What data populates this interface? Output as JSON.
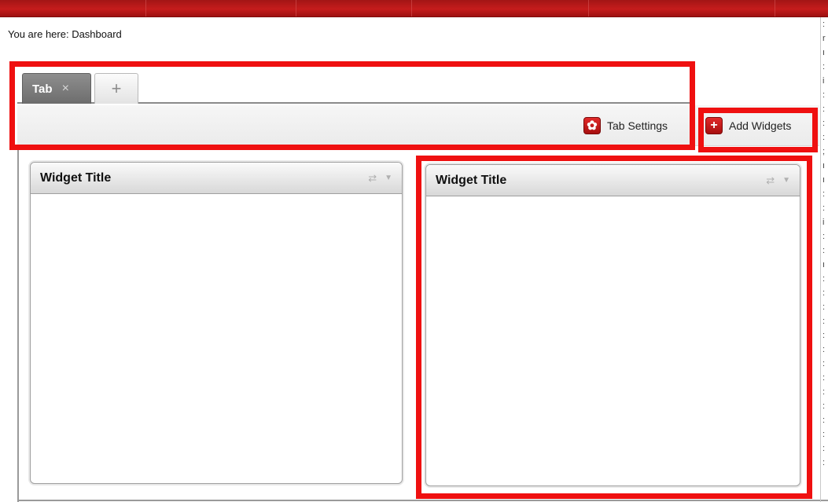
{
  "breadcrumb": "You are here: Dashboard",
  "tabs": [
    {
      "label": "Tab",
      "close_glyph": "×"
    }
  ],
  "add_tab_glyph": "+",
  "toolbar": {
    "tab_settings_label": "Tab Settings",
    "tab_settings_icon": "gear-icon",
    "add_widgets_label": "Add Widgets",
    "add_widgets_icon": "plus-icon",
    "add_widgets_glyph": "+",
    "tab_settings_glyph": "✿"
  },
  "widgets": [
    {
      "title": "Widget Title",
      "refresh_glyph": "⇄",
      "menu_glyph": "▼"
    },
    {
      "title": "Widget Title",
      "refresh_glyph": "⇄",
      "menu_glyph": "▼"
    }
  ],
  "colors": {
    "header_red": "#c51c1c",
    "highlight_red": "#ef1010",
    "active_tab_gray": "#7a7a7a"
  }
}
